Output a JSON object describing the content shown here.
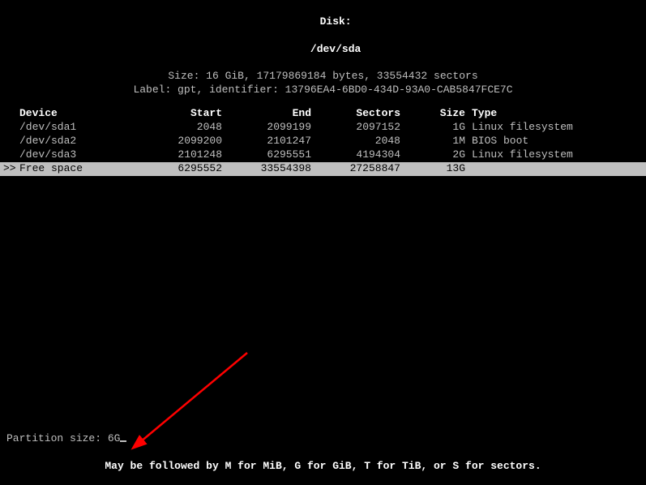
{
  "header": {
    "disk_label": "Disk:",
    "disk_path": "/dev/sda",
    "size_line": "Size: 16 GiB, 17179869184 bytes, 33554432 sectors",
    "label_line": "Label: gpt, identifier: 13796EA4-6BD0-434D-93A0-CAB5847FCE7C"
  },
  "columns": {
    "device": "Device",
    "start": "Start",
    "end": "End",
    "sectors": "Sectors",
    "size": "Size",
    "type": "Type"
  },
  "rows": [
    {
      "device": "/dev/sda1",
      "start": "2048",
      "end": "2099199",
      "sectors": "2097152",
      "size": "1G",
      "type": "Linux filesystem"
    },
    {
      "device": "/dev/sda2",
      "start": "2099200",
      "end": "2101247",
      "sectors": "2048",
      "size": "1M",
      "type": "BIOS boot"
    },
    {
      "device": "/dev/sda3",
      "start": "2101248",
      "end": "6295551",
      "sectors": "4194304",
      "size": "2G",
      "type": "Linux filesystem"
    }
  ],
  "selected": {
    "marker": ">>",
    "device": "Free space",
    "start": "6295552",
    "end": "33554398",
    "sectors": "27258847",
    "size": "13G",
    "type": ""
  },
  "prompt": {
    "label": "Partition size: ",
    "value": "6G"
  },
  "hint": "May be followed by M for MiB, G for GiB, T for TiB, or S for sectors."
}
